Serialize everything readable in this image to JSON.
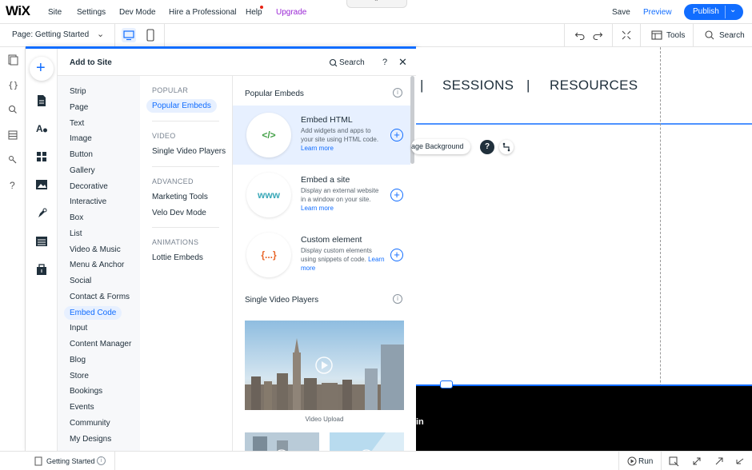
{
  "topbar": {
    "logo": "WiX",
    "menu": [
      "Site",
      "Settings",
      "Dev Mode",
      "Hire a Professional",
      "Help",
      "Upgrade"
    ],
    "handle_icon": "chevron-up-icon",
    "save": "Save",
    "preview": "Preview",
    "publish": "Publish"
  },
  "secondbar": {
    "page": "Page: Getting Started",
    "tools": "Tools",
    "search": "Search"
  },
  "panel": {
    "title": "Add to Site",
    "search": "Search",
    "help": "?",
    "categories": [
      "Strip",
      "Page",
      "Text",
      "Image",
      "Button",
      "Gallery",
      "Decorative",
      "Interactive",
      "Box",
      "List",
      "Video & Music",
      "Menu & Anchor",
      "Social",
      "Contact & Forms",
      "Embed Code",
      "Input",
      "Content Manager",
      "Blog",
      "Store",
      "Bookings",
      "Events",
      "Community",
      "My Designs"
    ],
    "active_category": "Embed Code",
    "sub_sections": [
      {
        "header": "POPULAR",
        "items": [
          "Popular Embeds"
        ]
      },
      {
        "header": "VIDEO",
        "items": [
          "Single Video Players"
        ]
      },
      {
        "header": "ADVANCED",
        "items": [
          "Marketing Tools",
          "Velo Dev Mode"
        ]
      },
      {
        "header": "ANIMATIONS",
        "items": [
          "Lottie Embeds"
        ]
      }
    ],
    "content": {
      "section1": "Popular Embeds",
      "embeds": [
        {
          "icon": "</>",
          "title": "Embed HTML",
          "desc": "Add widgets and apps to your site using HTML code.",
          "link": "Learn more"
        },
        {
          "icon": "www",
          "title": "Embed a site",
          "desc": "Display an external website in a window on your site.",
          "link": "Learn more"
        },
        {
          "icon": "{...}",
          "title": "Custom element",
          "desc": "Display custom elements using snippets of code.",
          "link": "Learn more"
        }
      ],
      "section2": "Single Video Players",
      "video_label": "Video Upload"
    }
  },
  "canvas": {
    "nav": [
      "|",
      "SESSIONS",
      "|",
      "RESOURCES"
    ],
    "bg_chip": "age Background",
    "q": "?",
    "black_text": "in"
  },
  "bottombar": {
    "page": "Getting Started",
    "run": "Run"
  },
  "colors": {
    "accent": "#116dff",
    "upgrade": "#9a27d5",
    "highlight": "#e7f0ff"
  }
}
